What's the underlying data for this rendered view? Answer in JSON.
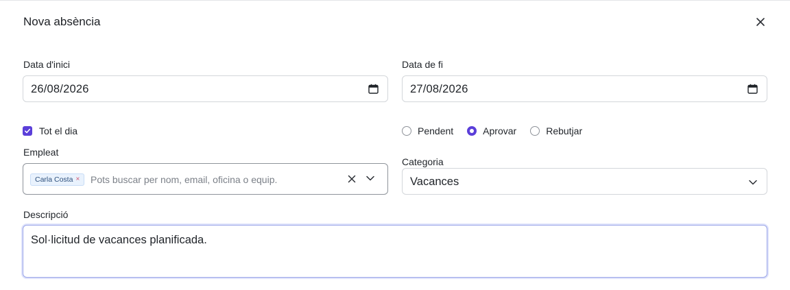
{
  "dialog": {
    "title": "Nova absència"
  },
  "start_date": {
    "label": "Data d'inici",
    "value": "26/08/2026"
  },
  "end_date": {
    "label": "Data de fi",
    "value": "27/08/2026"
  },
  "all_day": {
    "label": "Tot el dia",
    "checked": true
  },
  "status": {
    "options": [
      {
        "label": "Pendent",
        "selected": false
      },
      {
        "label": "Aprovar",
        "selected": true
      },
      {
        "label": "Rebutjar",
        "selected": false
      }
    ]
  },
  "employee": {
    "label": "Empleat",
    "selected_tag": "Carla Costa",
    "tag_remove": "×",
    "placeholder": "Pots buscar per nom, email, oficina o equip."
  },
  "category": {
    "label": "Categoria",
    "value": "Vacances"
  },
  "description": {
    "label": "Descripció",
    "value": "Sol·licitud de vacances planificada."
  },
  "colors": {
    "accent": "#5b3fd9",
    "focus_border": "#9aa5e8",
    "tag_bg": "#e9f2fd"
  },
  "icons": {
    "close": "close-icon",
    "calendar": "calendar-icon",
    "check": "check-icon",
    "clear": "clear-icon",
    "chevron": "chevron-down-icon"
  }
}
